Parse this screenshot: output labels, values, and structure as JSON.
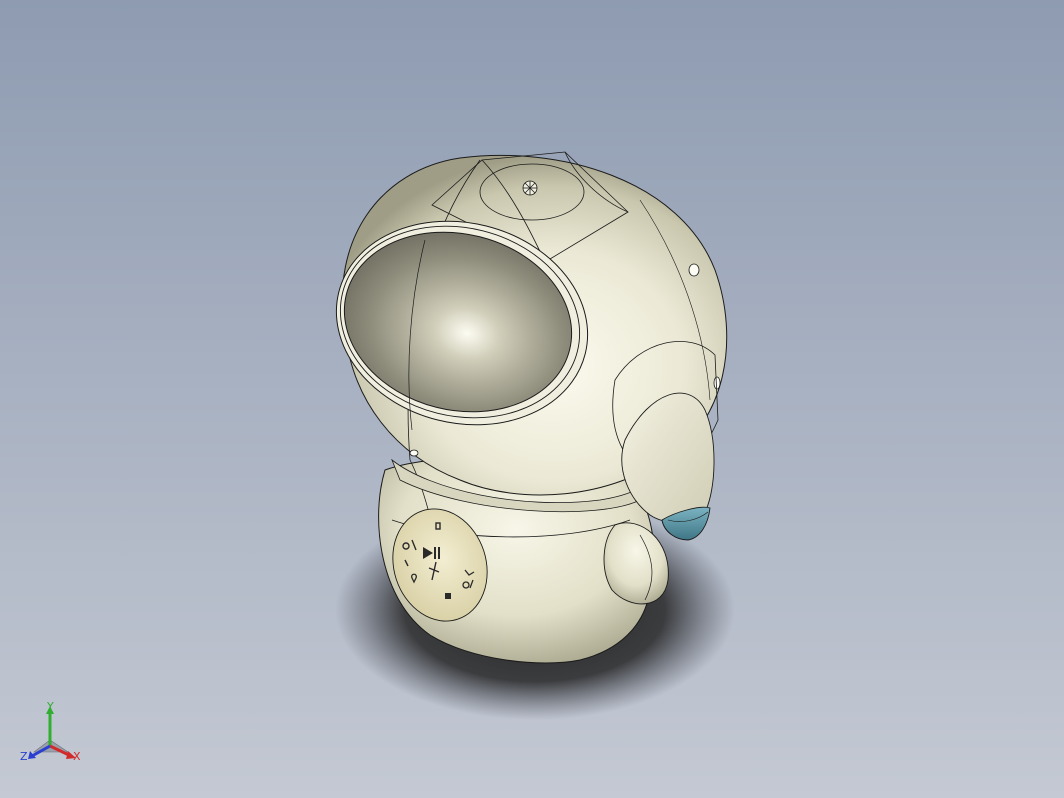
{
  "viewport": {
    "background_top": "#8e9bb1",
    "background_bottom": "#c4c9d3"
  },
  "model": {
    "body_color": "#ebe9d5",
    "body_shadow": "#8c8a74",
    "visor_color": "#9a9888",
    "nose_tip_color": "#5c98a8",
    "panel_color": "#e3dcb8",
    "edge_color": "#1b1b1b"
  },
  "triad": {
    "y_label": "Y",
    "x_label": "X",
    "z_label": "Z",
    "y_color": "#2fae2f",
    "x_color": "#d22a2a",
    "z_color": "#2a3fd2"
  }
}
